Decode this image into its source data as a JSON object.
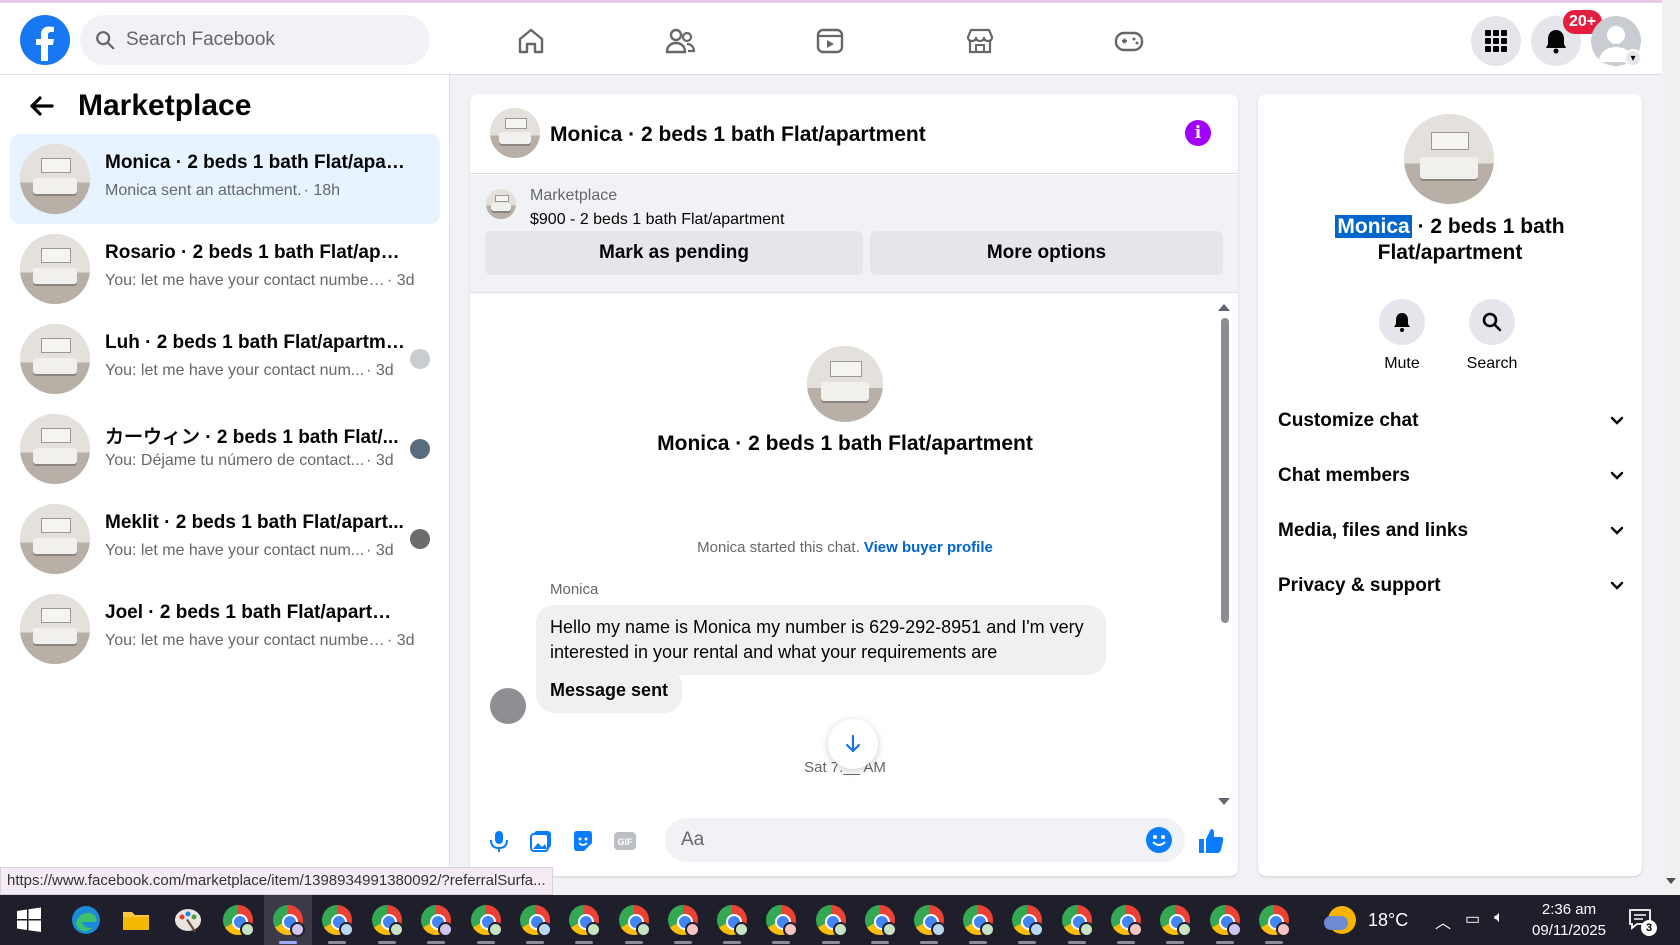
{
  "topbar": {
    "search_placeholder": "Search Facebook",
    "notifications_badge": "20+",
    "nav": [
      "home-icon",
      "friends-icon",
      "video-icon",
      "marketplace-icon",
      "gaming-icon"
    ],
    "brand_color": "#1877f2"
  },
  "left": {
    "title": "Marketplace",
    "conversations": [
      {
        "title": "Monica · 2 beds 1 bath Flat/apart...",
        "snippet": "Monica sent an attachment.",
        "time": " · 18h",
        "active": true
      },
      {
        "title": "Rosario · 2 beds 1 bath Flat/apart...",
        "snippet": "You: let me have your contact number...",
        "time": " · 3d"
      },
      {
        "title": "Luh · 2 beds 1 bath Flat/apartme...",
        "snippet": "You: let me have your contact num...",
        "time": " · 3d"
      },
      {
        "title": "カーウィン · 2 beds 1 bath Flat/...",
        "snippet": "You: Déjame tu número de contact...",
        "time": " · 3d"
      },
      {
        "title": "Meklit · 2 beds 1 bath Flat/apart...",
        "snippet": "You: let me have your contact num...",
        "time": " · 3d"
      },
      {
        "title": "Joel · 2 beds 1 bath Flat/apartment",
        "snippet": "You: let me have your contact number...",
        "time": " · 3d"
      }
    ]
  },
  "chat": {
    "title": "Monica · 2 beds 1 bath Flat/apartment",
    "listing_label": "Marketplace",
    "listing_price": "$900 - 2 beds 1 bath Flat/apartment",
    "mark_pending": "Mark as pending",
    "more_options": "More options",
    "intro_title": "Monica · 2 beds 1 bath Flat/apartment",
    "started_text": "Monica started this chat.",
    "view_profile": "View buyer profile",
    "sender": "Monica",
    "message1": "Hello my name is Monica my number is 629-292-8951 and I'm very interested in your rental and what your requirements are",
    "message2": "Message sent",
    "daystamp": "Sat 7:__ AM",
    "composer_placeholder": "Aa",
    "accent": "#0a7cff",
    "info_color": "#a100ff"
  },
  "right": {
    "title_highlight": "Monica",
    "title_rest": " · 2 beds 1 bath Flat/apartment",
    "mute": "Mute",
    "search": "Search",
    "sections": [
      "Customize chat",
      "Chat members",
      "Media, files and links",
      "Privacy & support"
    ]
  },
  "status_url": "https://www.facebook.com/marketplace/item/1398934991380092/?referralSurfa...",
  "taskbar": {
    "temperature": "18°C",
    "time": "2:36 am",
    "date": "09/11/2025",
    "notification_count": "3"
  }
}
